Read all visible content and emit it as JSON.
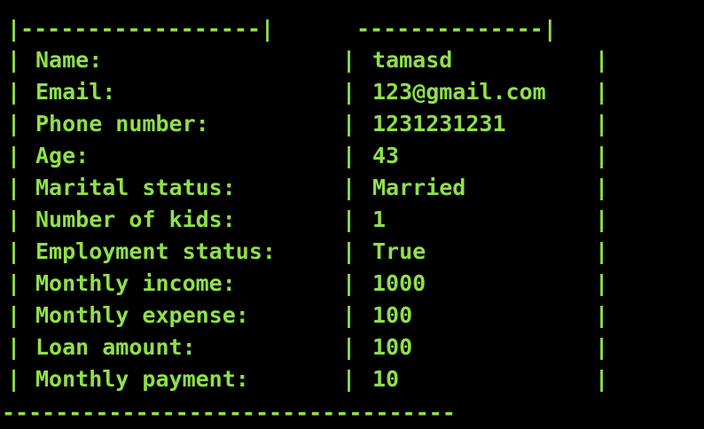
{
  "terminal": {
    "partial_top_line": "20",
    "separator_top_left": "|------------------|",
    "separator_top_right": "--------------|",
    "separator_bottom": "----------------------------------",
    "rows": [
      {
        "label": "Name:",
        "value": "tamasd"
      },
      {
        "label": "Email:",
        "value": "123@gmail.com"
      },
      {
        "label": "Phone number:",
        "value": "1231231231"
      },
      {
        "label": "Age:",
        "value": "43"
      },
      {
        "label": "Marital status:",
        "value": "Married"
      },
      {
        "label": "Number of kids:",
        "value": "1"
      },
      {
        "label": "Employment status:",
        "value": "True"
      },
      {
        "label": "Monthly income:",
        "value": "1000"
      },
      {
        "label": "Monthly expense:",
        "value": "100"
      },
      {
        "label": "Loan amount:",
        "value": "100"
      },
      {
        "label": "Monthly payment:",
        "value": "10"
      }
    ],
    "colors": {
      "background": "#000000",
      "text": "#8fe04b"
    }
  }
}
